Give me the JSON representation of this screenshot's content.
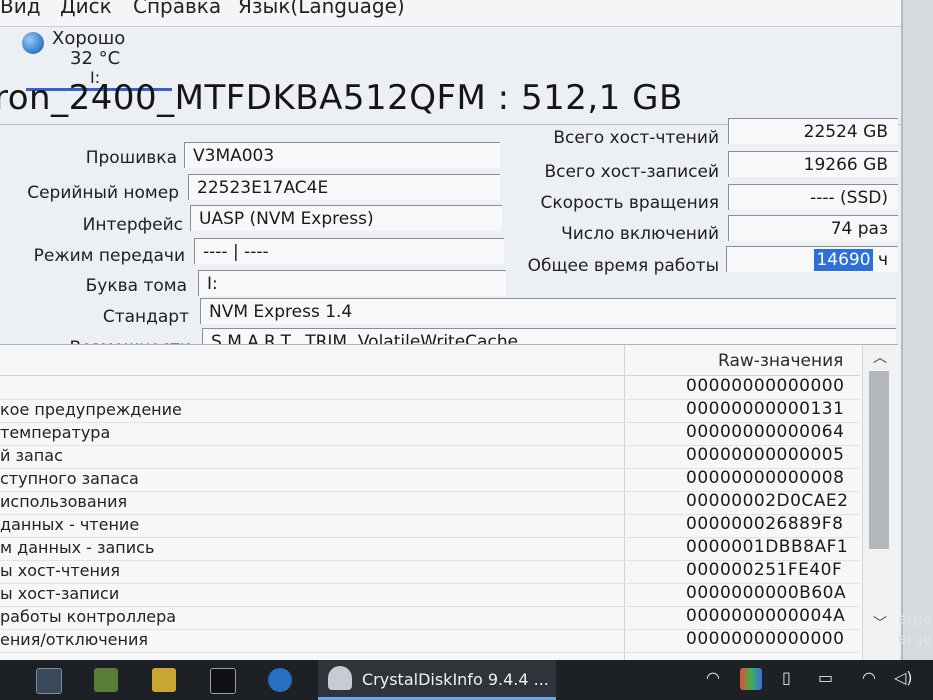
{
  "menu": {
    "items": [
      "Вид",
      "Диск",
      "Справка",
      "Язык(Language)"
    ]
  },
  "status": {
    "health": "Хорошо",
    "temperature": "32 °C",
    "drive": "I:"
  },
  "title": {
    "model": "ron_2400_MTFDKBA512QFM : 512,1 GB"
  },
  "info": {
    "firmware_label": "Прошивка",
    "firmware": "V3MA003",
    "serial_label": "Серийный номер",
    "serial": "22523E17AC4E",
    "interface_label": "Интерфейс",
    "interface": "UASP (NVM Express)",
    "transfer_label": "Режим передачи",
    "transfer": "---- | ----",
    "volume_label": "Буква тома",
    "volume": "I:",
    "standard_label": "Стандарт",
    "standard": "NVM Express 1.4",
    "features_label": "Возможности",
    "features": "S.M.A.R.T., TRIM, VolatileWriteCache"
  },
  "stats": {
    "host_reads_label": "Всего хост-чтений",
    "host_reads": "22524 GB",
    "host_writes_label": "Всего хост-записей",
    "host_writes": "19266 GB",
    "rotation_label": "Скорость вращения",
    "rotation": "---- (SSD)",
    "power_count_label": "Число включений",
    "power_count": "74 раз",
    "power_hours_label": "Общее время работы",
    "power_hours": "14690",
    "power_hours_unit": "ч"
  },
  "table": {
    "raw_header": "Raw-значения",
    "rows": [
      {
        "name": "",
        "raw": "00000000000000"
      },
      {
        "name": "кое предупреждение",
        "raw": "00000000000131"
      },
      {
        "name": "температура",
        "raw": "00000000000064"
      },
      {
        "name": "й запас",
        "raw": "00000000000005"
      },
      {
        "name": "ступного запаса",
        "raw": "00000000000008"
      },
      {
        "name": "использования",
        "raw": "00000002D0CAE2"
      },
      {
        "name": "данных - чтение",
        "raw": "000000026889F8"
      },
      {
        "name": "м данных - запись",
        "raw": "0000001DBB8AF1"
      },
      {
        "name": "ы хост-чтения",
        "raw": "000000251FE40F"
      },
      {
        "name": "ы хост-записи",
        "raw": "0000000000B60A"
      },
      {
        "name": "работы контроллера",
        "raw": "0000000000004A"
      },
      {
        "name": "ения/отключения",
        "raw": "00000000000000"
      }
    ]
  },
  "edge": {
    "label1": "erge",
    "label2": "erge"
  },
  "taskbar": {
    "app_title": "CrystalDiskInfo 9.4.4 ..."
  }
}
